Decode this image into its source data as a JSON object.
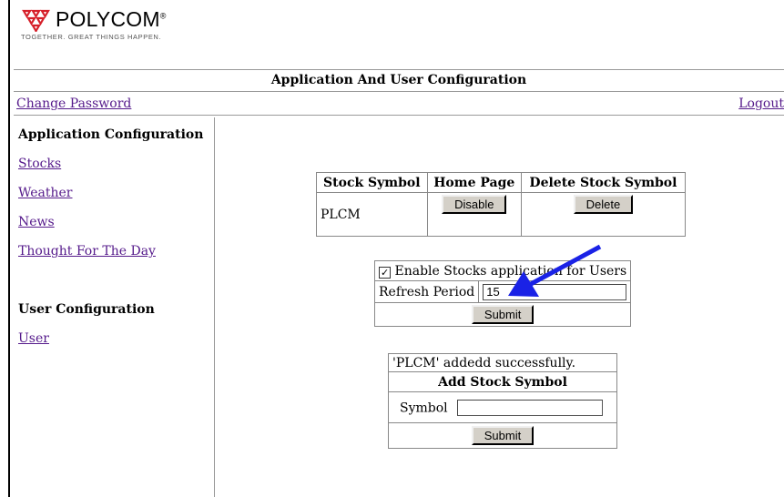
{
  "brand": {
    "name": "POLYCOM",
    "mark": "®",
    "tagline": "TOGETHER. GREAT THINGS HAPPEN."
  },
  "page_title": "Application And User Configuration",
  "nav": {
    "change_password": "Change Password",
    "logout": "Logout"
  },
  "sidebar": {
    "app_heading": "Application Configuration",
    "app_items": [
      {
        "label": "Stocks"
      },
      {
        "label": "Weather"
      },
      {
        "label": "News"
      },
      {
        "label": "Thought For The Day"
      }
    ],
    "user_heading": "User Configuration",
    "user_items": [
      {
        "label": "User"
      }
    ]
  },
  "stock_table": {
    "headers": [
      "Stock Symbol",
      "Home Page",
      "Delete Stock Symbol"
    ],
    "rows": [
      {
        "symbol": "PLCM",
        "home_button": "Disable",
        "delete_button": "Delete"
      }
    ]
  },
  "settings": {
    "enable_label": "Enable Stocks application for Users",
    "enable_checked": true,
    "refresh_label": "Refresh Period",
    "refresh_value": "15",
    "submit_label": "Submit"
  },
  "add_form": {
    "status": "'PLCM' addedd successfully.",
    "heading": "Add Stock Symbol",
    "symbol_label": "Symbol",
    "symbol_value": "",
    "submit_label": "Submit"
  },
  "colors": {
    "brand_red": "#d6202a",
    "link": "#551a8b",
    "arrow": "#1a22e6",
    "button_face": "#d4d0c8"
  }
}
